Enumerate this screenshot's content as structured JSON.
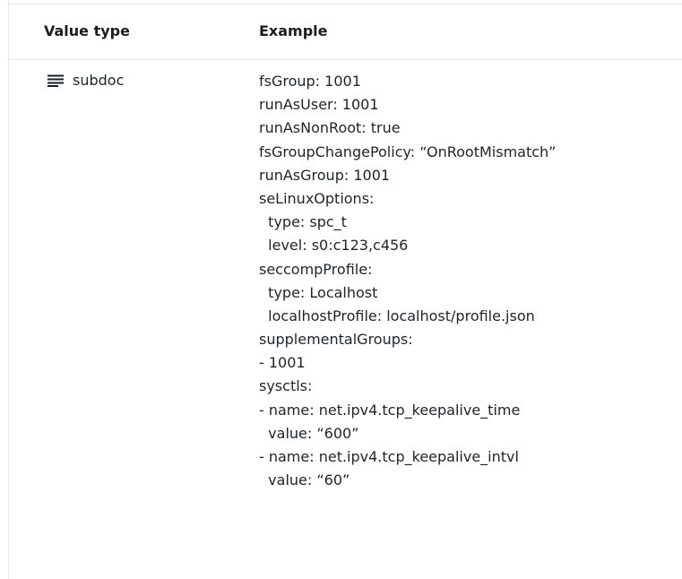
{
  "table": {
    "headers": {
      "value_type": "Value type",
      "example": "Example"
    },
    "row": {
      "type_icon": "subdoc-lines-icon",
      "type_label": "subdoc",
      "example_lines": [
        "fsGroup: 1001",
        "runAsUser: 1001",
        "runAsNonRoot: true",
        "fsGroupChangePolicy: “OnRootMismatch”",
        "runAsGroup: 1001",
        "seLinuxOptions:",
        "  type: spc_t",
        "  level: s0:c123,c456",
        "seccompProfile:",
        "  type: Localhost",
        "  localhostProfile: localhost/profile.json",
        "supplementalGroups:",
        "- 1001",
        "sysctls:",
        "- name: net.ipv4.tcp_keepalive_time",
        "  value: “600”",
        "- name: net.ipv4.tcp_keepalive_intvl",
        "  value: “60”"
      ]
    }
  }
}
